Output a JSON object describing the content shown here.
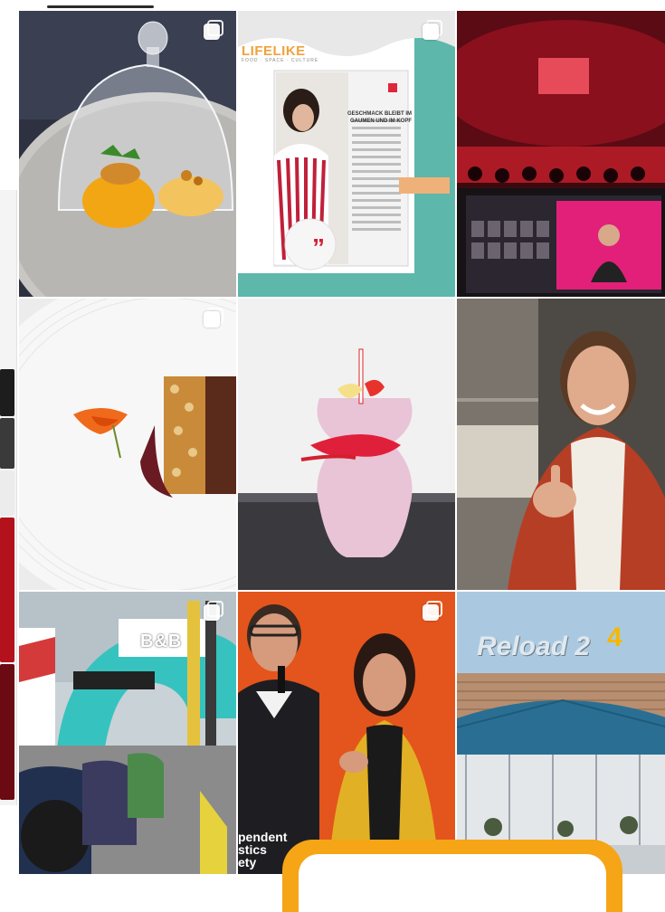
{
  "app": {
    "tab_indicator": "active-tab"
  },
  "grid": {
    "posts": [
      {
        "id": "post-1",
        "subject": "dessert-under-glass-cloche",
        "multiple": true
      },
      {
        "id": "post-2",
        "subject": "magazine-article",
        "multiple": true,
        "magazine_title": "LIFELIKE",
        "magazine_tagline": "FOOD · SPACE · CULTURE",
        "article_heading": "GESCHMACK BLEIBT IM GAUMEN UND IM KOPF",
        "quote_mark": "”"
      },
      {
        "id": "post-3",
        "subject": "event-stage-red-lights",
        "multiple": false
      },
      {
        "id": "post-4",
        "subject": "plated-dish-with-nasturtium",
        "multiple": true
      },
      {
        "id": "post-5",
        "subject": "pink-smoothie-bottle",
        "multiple": false
      },
      {
        "id": "post-6",
        "subject": "smiling-woman-thumbs-up",
        "multiple": false
      },
      {
        "id": "post-7",
        "subject": "classic-car-event",
        "multiple": true,
        "banner_text": "B&B"
      },
      {
        "id": "post-8",
        "subject": "panel-discussion-stage",
        "multiple": true,
        "stage_text": "pendent\nstics\nety"
      },
      {
        "id": "post-9",
        "subject": "restaurant-terrace",
        "multiple": false,
        "sign_text": "Reload 2",
        "sign_bolt": "4"
      }
    ]
  },
  "colors": {
    "accent": "#f5a516",
    "icon": "#ffffff"
  }
}
